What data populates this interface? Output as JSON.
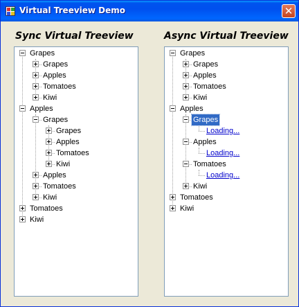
{
  "window": {
    "title": "Virtual Treeview Demo",
    "close_glyph": "✕"
  },
  "left": {
    "heading": "Sync Virtual Treeview",
    "nodes": [
      {
        "label": "Grapes",
        "state": "expanded"
      },
      {
        "label": "Grapes",
        "state": "collapsed"
      },
      {
        "label": "Apples",
        "state": "collapsed"
      },
      {
        "label": "Tomatoes",
        "state": "collapsed"
      },
      {
        "label": "Kiwi",
        "state": "collapsed"
      },
      {
        "label": "Apples",
        "state": "expanded"
      },
      {
        "label": "Grapes",
        "state": "expanded"
      },
      {
        "label": "Grapes",
        "state": "collapsed"
      },
      {
        "label": "Apples",
        "state": "collapsed"
      },
      {
        "label": "Tomatoes",
        "state": "collapsed"
      },
      {
        "label": "Kiwi",
        "state": "collapsed"
      },
      {
        "label": "Apples",
        "state": "collapsed"
      },
      {
        "label": "Tomatoes",
        "state": "collapsed"
      },
      {
        "label": "Kiwi",
        "state": "collapsed"
      },
      {
        "label": "Tomatoes",
        "state": "collapsed"
      },
      {
        "label": "Kiwi",
        "state": "collapsed"
      }
    ]
  },
  "right": {
    "heading": "Async Virtual Treeview",
    "nodes": [
      {
        "label": "Grapes",
        "state": "expanded"
      },
      {
        "label": "Grapes",
        "state": "collapsed"
      },
      {
        "label": "Apples",
        "state": "collapsed"
      },
      {
        "label": "Tomatoes",
        "state": "collapsed"
      },
      {
        "label": "Kiwi",
        "state": "collapsed"
      },
      {
        "label": "Apples",
        "state": "expanded"
      },
      {
        "label": "Grapes",
        "state": "expanded",
        "selected": true
      },
      {
        "label": "Loading...",
        "state": "loading"
      },
      {
        "label": "Apples",
        "state": "expanded"
      },
      {
        "label": "Loading...",
        "state": "loading"
      },
      {
        "label": "Tomatoes",
        "state": "expanded"
      },
      {
        "label": "Loading...",
        "state": "loading"
      },
      {
        "label": "Kiwi",
        "state": "collapsed"
      },
      {
        "label": "Tomatoes",
        "state": "collapsed"
      },
      {
        "label": "Kiwi",
        "state": "collapsed"
      }
    ]
  }
}
